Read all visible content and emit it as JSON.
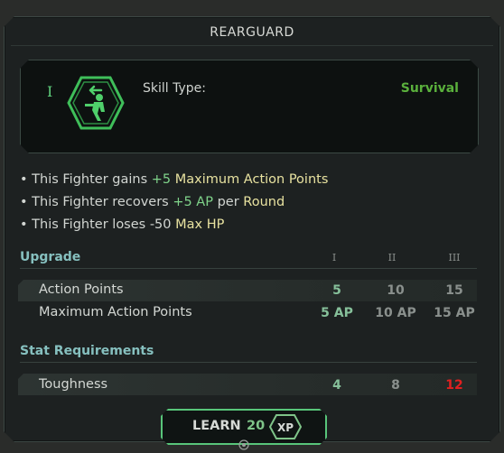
{
  "dialog": {
    "title": "REARGUARD",
    "rank_numeral": "I",
    "skill_type_label": "Skill Type:",
    "skill_type_value": "Survival",
    "skill_icon": "fighter-retreat-icon"
  },
  "effects": [
    {
      "prefix": "• This Fighter gains",
      "value": "+5",
      "middle": "",
      "stat": "Maximum Action Points"
    },
    {
      "prefix": "• This Fighter recovers",
      "value": "+5 AP",
      "middle": "per",
      "stat": "Round"
    },
    {
      "prefix": "• This Fighter loses",
      "value": "-50",
      "middle": "",
      "stat": "Max HP"
    }
  ],
  "upgrade": {
    "heading": "Upgrade",
    "levels": [
      "I",
      "II",
      "III"
    ],
    "rows": [
      {
        "label": "Action Points",
        "values": [
          "5",
          "10",
          "15"
        ]
      },
      {
        "label": "Maximum Action Points",
        "values": [
          "5 AP",
          "10 AP",
          "15 AP"
        ]
      }
    ]
  },
  "requirements": {
    "heading": "Stat Requirements",
    "rows": [
      {
        "label": "Toughness",
        "values": [
          "4",
          "8",
          "12"
        ]
      }
    ]
  },
  "learn_button": {
    "label": "LEARN",
    "cost": "20",
    "currency": "XP"
  },
  "colors": {
    "accent_green": "#58c57a",
    "survival_green": "#5ab03c",
    "unmet_red": "#e02020",
    "heading_teal": "#86c0bf"
  }
}
